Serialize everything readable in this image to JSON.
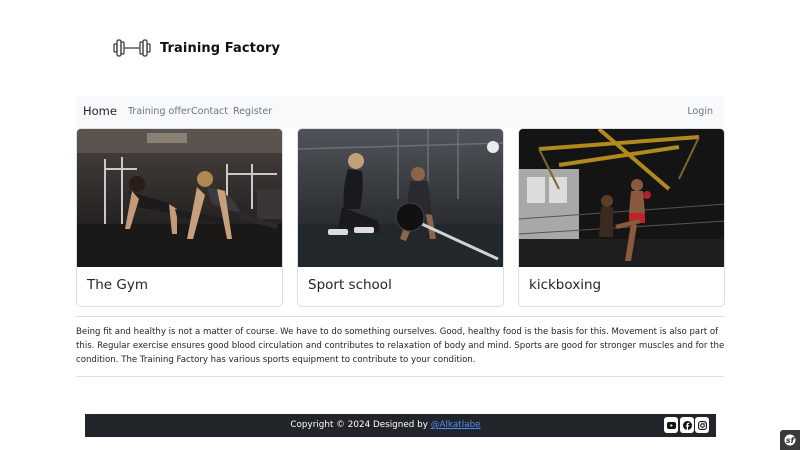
{
  "brand": {
    "name": "Training Factory",
    "logo_icon": "dumbbell-icon"
  },
  "nav": {
    "home": "Home",
    "links": [
      "Training offer",
      "Contact",
      "Register"
    ],
    "login": "Login"
  },
  "cards": [
    {
      "title": "The Gym"
    },
    {
      "title": "Sport school"
    },
    {
      "title": "kickboxing"
    }
  ],
  "intro": "Being fit and healthy is not a matter of course. We have to do something ourselves. Good, healthy food is the basis for this. Movement is also part of this. Regular exercise ensures good blood circulation and contributes to relaxation of body and mind. Sports are good for stronger muscles and for the condition. The Training Factory has various sports equipment to contribute to your condition.",
  "footer": {
    "copyright": "Copyright © 2024 Designed by ",
    "designer": "@Alkatlabe",
    "social_icons": [
      "youtube-icon",
      "facebook-icon",
      "instagram-icon"
    ]
  },
  "colors": {
    "footer_bg": "#212529",
    "navbar_bg": "#f8f9fa",
    "link": "#4d8cff"
  }
}
